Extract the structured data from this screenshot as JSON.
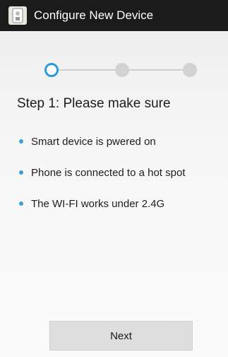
{
  "window": {
    "title": "Configure New Device",
    "icon": "device-app-icon"
  },
  "stepper": {
    "steps": [
      {
        "state": "active",
        "color": "#2b9bd8"
      },
      {
        "state": "inactive",
        "color": "#d2d2d2"
      },
      {
        "state": "inactive",
        "color": "#d2d2d2"
      }
    ]
  },
  "main": {
    "heading": "Step 1: Please make sure",
    "bullets": [
      "Smart device is pwered on",
      "Phone is connected to a hot spot",
      "The WI-FI works under 2.4G"
    ],
    "bullet_color": "#3aa0d8"
  },
  "footer": {
    "next_label": "Next"
  }
}
